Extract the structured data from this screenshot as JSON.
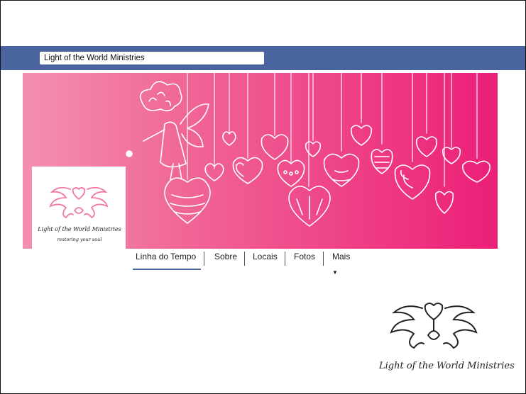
{
  "header": {
    "search_value": "Light of the World Ministries"
  },
  "profile": {
    "logo_title": "Light of the World Ministries",
    "logo_subtitle": "restoring your soul"
  },
  "tabs": [
    {
      "label": "Linha do Tempo",
      "active": true
    },
    {
      "label": "Sobre",
      "active": false
    },
    {
      "label": "Locais",
      "active": false
    },
    {
      "label": "Fotos",
      "active": false
    },
    {
      "label": "Mais",
      "active": false
    }
  ],
  "watermark_logo": {
    "title": "Light of the World Ministries"
  },
  "colors": {
    "topbar": "#4a64a0",
    "cover_start": "#f48fb1",
    "cover_end": "#ec1f78",
    "logo_pink": "#f07aa0"
  }
}
